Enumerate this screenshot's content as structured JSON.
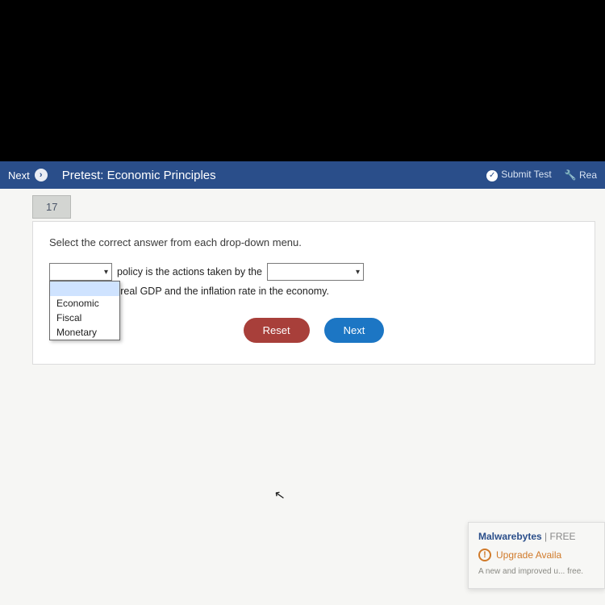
{
  "topbar": {
    "nav_next": "Next",
    "title": "Pretest: Economic Principles",
    "submit": "Submit Test",
    "reader": "Rea"
  },
  "question": {
    "number": "17",
    "instruction": "Select the correct answer from each drop-down menu.",
    "sentence_part1": "policy is the actions taken by the",
    "sentence_part2": "to influence the real GDP and the inflation rate in the economy.",
    "dropdown1": {
      "selected": "",
      "options": [
        "Economic",
        "Fiscal",
        "Monetary"
      ]
    },
    "dropdown2": {
      "selected": ""
    },
    "reset_label": "Reset",
    "next_label": "Next"
  },
  "popup": {
    "brand": "Malwarebytes",
    "tier": "FREE",
    "headline": "Upgrade Availa",
    "body": "A new and improved u... free."
  }
}
